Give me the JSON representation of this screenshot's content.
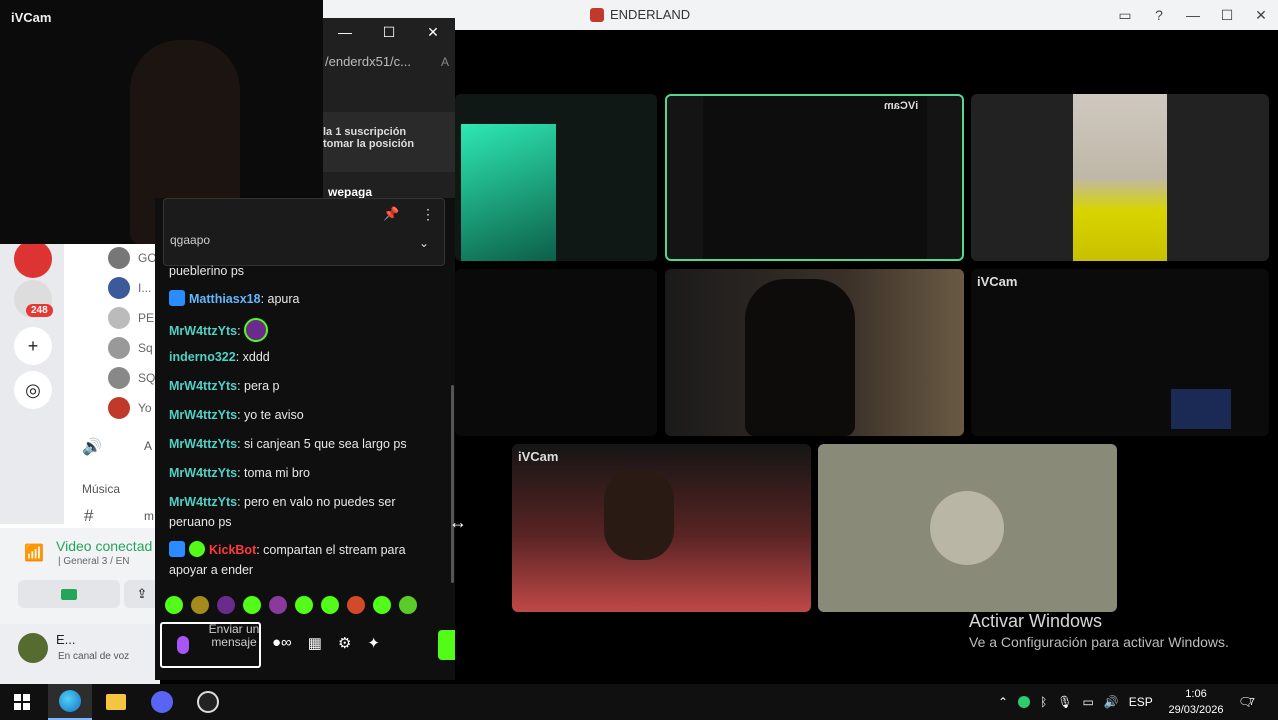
{
  "window": {
    "title": "ENDERLAND"
  },
  "ivcam": {
    "title": "iVCam"
  },
  "browser": {
    "url": "/enderdx51/c...",
    "sub_line1": "la 1 suscripción",
    "sub_line2": "tomar la posición",
    "pinned_top_word": "wepaga",
    "pinned_partial": "qgaapo"
  },
  "chat": {
    "messages": [
      {
        "user": "",
        "text": "pueblerino ps"
      },
      {
        "user": "Matthiasx18",
        "text": ": apura"
      },
      {
        "user": "MrW4ttzYts",
        "text": ":"
      },
      {
        "user": "inderno322",
        "text": ": xddd"
      },
      {
        "user": "MrW4ttzYts",
        "text": ": pera p"
      },
      {
        "user": "MrW4ttzYts",
        "text": ": yo te aviso"
      },
      {
        "user": "MrW4ttzYts",
        "text": ": si canjean 5 que sea largo ps"
      },
      {
        "user": "MrW4ttzYts",
        "text": ": toma mi bro"
      },
      {
        "user": "MrW4ttzYts",
        "text": ": pero en valo no puedes ser peruano ps"
      },
      {
        "user": "KickBot",
        "text": ": compartan el stream para apoyar a ender"
      }
    ],
    "input_placeholder": "Enviar un mensaje"
  },
  "discord": {
    "server_badge": "248",
    "members": [
      "GO",
      "I...",
      "PE",
      "Sq",
      "SQ",
      "Yo"
    ],
    "channel_partial": "A",
    "music_label": "Música",
    "text_channel_partial": "m",
    "voice_connected": "Video conectad",
    "voice_sub": "| General 3 / EN",
    "user_name": "E...",
    "user_status": "En canal de voz"
  },
  "grid": {
    "tile_labels": {
      "top_middle_mirrored": "iVCam",
      "mid_right": "iVCam",
      "bottom_left": "iVCam"
    }
  },
  "watermark": {
    "title": "Activar Windows",
    "subtitle": "Ve a Configuración para activar Windows."
  },
  "taskbar": {
    "lang": "ESP",
    "time": "1:06",
    "date": "29/03/2026",
    "notif_count": "7"
  },
  "colors": {
    "kick_green": "#53fc18",
    "username_cyan": "#4fd1c5",
    "selected_tile_border": "#57d68d"
  }
}
